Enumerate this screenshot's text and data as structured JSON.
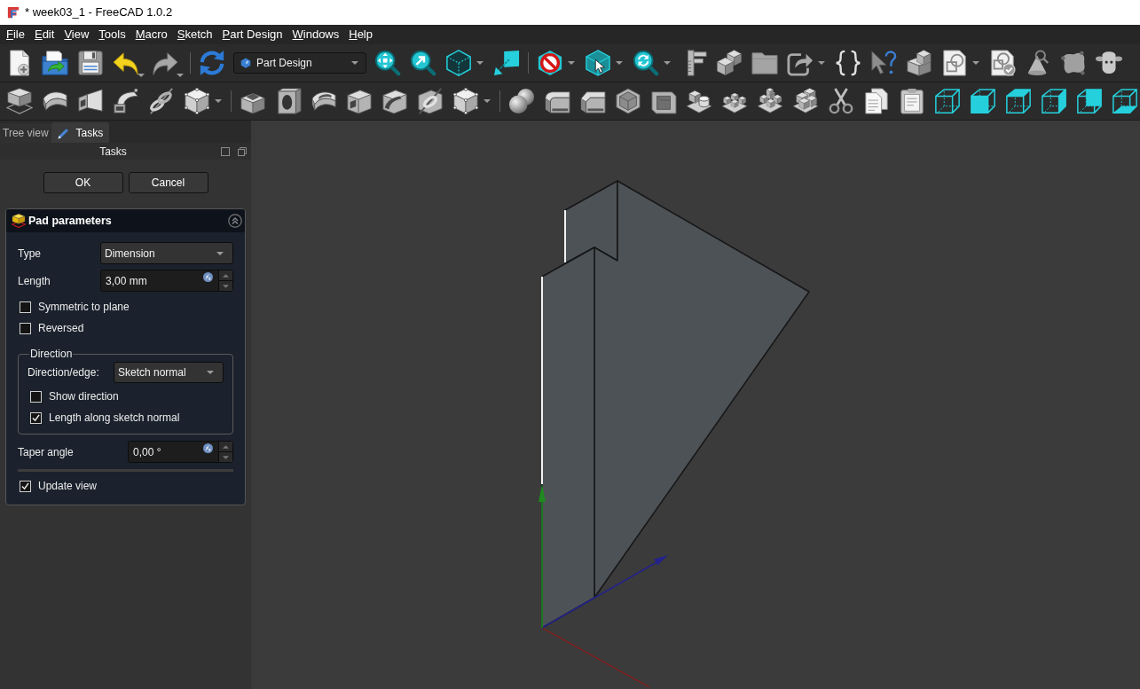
{
  "window": {
    "title": "* week03_1 - FreeCAD 1.0.2"
  },
  "menu_bar": [
    {
      "label": "File",
      "mnemonic_underlined": true
    },
    {
      "label": "Edit",
      "mnemonic_underlined": true
    },
    {
      "label": "View",
      "mnemonic_underlined": true
    },
    {
      "label": "Tools",
      "mnemonic_underlined": true
    },
    {
      "label": "Macro",
      "mnemonic_underlined": true
    },
    {
      "label": "Sketch",
      "mnemonic_underlined": true
    },
    {
      "label": "Part Design",
      "mnemonic_underlined": true
    },
    {
      "label": "Windows",
      "mnemonic_underlined": true
    },
    {
      "label": "Help",
      "mnemonic_underlined": true
    }
  ],
  "workbench_selector": {
    "value": "Part Design"
  },
  "side_panel": {
    "tabs": [
      {
        "label": "Tree view",
        "selected": false
      },
      {
        "label": "Tasks",
        "selected": true
      }
    ],
    "title": "Tasks",
    "buttons": [
      "OK",
      "Cancel"
    ],
    "pad_parameters": {
      "title": "Pad parameters",
      "expanded": true,
      "fields": [
        {
          "kind": "combo",
          "label": "Type",
          "value": "Dimension"
        },
        {
          "kind": "spin",
          "label": "Length",
          "value": "3,00 mm"
        }
      ],
      "options": [
        {
          "label": "Symmetric to plane",
          "checked": false
        },
        {
          "label": "Reversed",
          "checked": false
        }
      ],
      "direction": {
        "title": "Direction",
        "edge_label": "Direction/edge:",
        "edge_value": "Sketch normal",
        "options": [
          {
            "label": "Show direction",
            "checked": false
          },
          {
            "label": "Length along sketch normal",
            "checked": true
          }
        ]
      },
      "taper": {
        "label": "Taper angle",
        "value": "0,00 °"
      },
      "update_view": {
        "label": "Update view",
        "checked": true
      }
    }
  }
}
